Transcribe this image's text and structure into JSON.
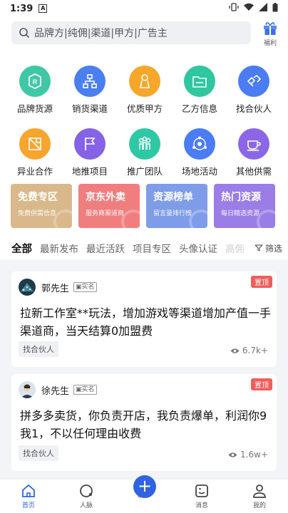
{
  "status": {
    "time": "1:39",
    "badge": "A"
  },
  "search": {
    "placeholder": "品牌方|纯佣|渠道|甲方|广告主",
    "gift_label": "福利"
  },
  "categories": [
    {
      "label": "品牌货源",
      "color": "#3ec8a6",
      "icon": "r-shield-icon"
    },
    {
      "label": "销货渠道",
      "color": "#4a7ff0",
      "icon": "network-icon"
    },
    {
      "label": "优质甲方",
      "color": "#f6a72a",
      "icon": "chef-icon"
    },
    {
      "label": "乙方信息",
      "color": "#2fc6a0",
      "icon": "folder-icon"
    },
    {
      "label": "找合伙人",
      "color": "#4b7cf3",
      "icon": "handshake-icon"
    },
    {
      "label": "异业合作",
      "color": "#f7a52d",
      "icon": "cube-icon"
    },
    {
      "label": "地推项目",
      "color": "#8662e6",
      "icon": "flag-icon"
    },
    {
      "label": "推广团队",
      "color": "#2fc8a4",
      "icon": "team-icon"
    },
    {
      "label": "场地活动",
      "color": "#4b7cf3",
      "icon": "hub-icon"
    },
    {
      "label": "其他供需",
      "color": "#8b67e8",
      "icon": "cup-icon"
    }
  ],
  "promos": [
    {
      "title": "免费专区",
      "sub": "免费供需信息",
      "color": "#d9b98b"
    },
    {
      "title": "京东外卖",
      "sub": "服务商渠道商",
      "color": "#f07e7e"
    },
    {
      "title": "资源榜单",
      "sub": "留言量排行榜",
      "color": "#7e9ce8"
    },
    {
      "title": "热门资源",
      "sub": "每日精选资源",
      "color": "#9a7de6"
    }
  ],
  "tabs": [
    "全部",
    "最新发布",
    "最近活跃",
    "项目专区",
    "头像认证",
    "高佣"
  ],
  "filter_label": "筛选",
  "posts": [
    {
      "name": "郭先生",
      "verified": "实名",
      "top_tag": "置顶",
      "content": "拉新工作室**玩法，增加游戏等渠道增加产值一手渠道商，当天结算0加盟费",
      "category": "找合伙人",
      "views": "6.7k+"
    },
    {
      "name": "徐先生",
      "verified": "实名",
      "top_tag": "置顶",
      "content": "拼多多卖货，你负责开店，我负责爆单，利润你9我1，不以任何理由收费",
      "category": "找合伙人",
      "views": "1.6w+"
    }
  ],
  "nav": {
    "home": "首页",
    "contacts": "人脉",
    "publish": "发布",
    "messages": "消息",
    "mine": "我的"
  },
  "colors": {
    "accent": "#2f63e0",
    "top_tag": "#f25c5c"
  }
}
